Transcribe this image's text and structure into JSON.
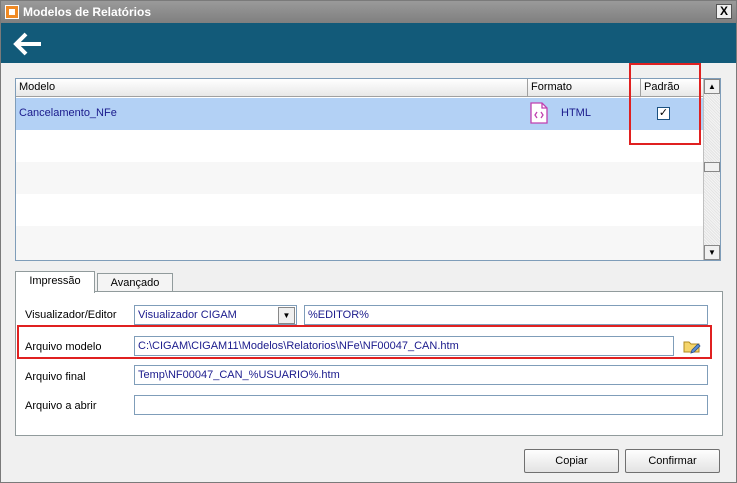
{
  "window": {
    "title": "Modelos de Relatórios",
    "close_label": "X"
  },
  "grid": {
    "columns": [
      "Modelo",
      "Formato",
      "Padrão"
    ],
    "rows": [
      {
        "modelo": "Cancelamento_NFe",
        "formato": "HTML",
        "padrao": true
      }
    ]
  },
  "tabs": [
    {
      "label": "Impressão",
      "active": true
    },
    {
      "label": "Avançado",
      "active": false
    }
  ],
  "form": {
    "visualizador_label": "Visualizador/Editor",
    "visualizador_value": "Visualizador CIGAM",
    "editor_value": "%EDITOR%",
    "arquivo_modelo_label": "Arquivo modelo",
    "arquivo_modelo_value": "C:\\CIGAM\\CIGAM11\\Modelos\\Relatorios\\NFe\\NF00047_CAN.htm",
    "arquivo_final_label": "Arquivo final",
    "arquivo_final_value": "Temp\\NF00047_CAN_%USUARIO%.htm",
    "arquivo_abrir_label": "Arquivo a abrir",
    "arquivo_abrir_value": ""
  },
  "buttons": {
    "copiar": "Copiar",
    "confirmar": "Confirmar"
  },
  "colors": {
    "toolbar": "#125a79",
    "selection": "#b3d1f5",
    "highlight": "#e02020"
  },
  "icons": {
    "back": "arrow-left-icon",
    "format": "html-file-icon",
    "browse": "folder-edit-icon"
  }
}
